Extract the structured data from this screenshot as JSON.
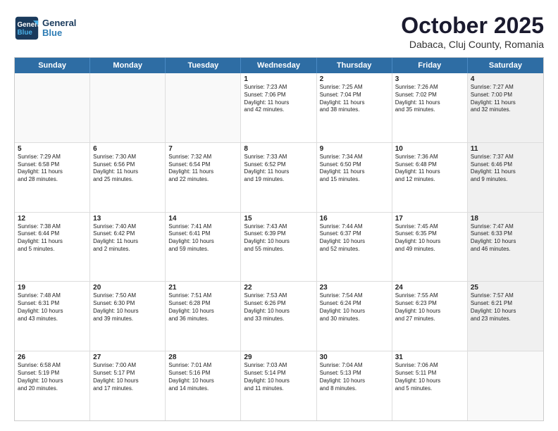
{
  "logo": {
    "line1": "General",
    "line2": "Blue"
  },
  "title": "October 2025",
  "subtitle": "Dabaca, Cluj County, Romania",
  "days": [
    "Sunday",
    "Monday",
    "Tuesday",
    "Wednesday",
    "Thursday",
    "Friday",
    "Saturday"
  ],
  "rows": [
    [
      {
        "day": "",
        "text": "",
        "empty": true
      },
      {
        "day": "",
        "text": "",
        "empty": true
      },
      {
        "day": "",
        "text": "",
        "empty": true
      },
      {
        "day": "1",
        "text": "Sunrise: 7:23 AM\nSunset: 7:06 PM\nDaylight: 11 hours\nand 42 minutes."
      },
      {
        "day": "2",
        "text": "Sunrise: 7:25 AM\nSunset: 7:04 PM\nDaylight: 11 hours\nand 38 minutes."
      },
      {
        "day": "3",
        "text": "Sunrise: 7:26 AM\nSunset: 7:02 PM\nDaylight: 11 hours\nand 35 minutes."
      },
      {
        "day": "4",
        "text": "Sunrise: 7:27 AM\nSunset: 7:00 PM\nDaylight: 11 hours\nand 32 minutes.",
        "shaded": true
      }
    ],
    [
      {
        "day": "5",
        "text": "Sunrise: 7:29 AM\nSunset: 6:58 PM\nDaylight: 11 hours\nand 28 minutes."
      },
      {
        "day": "6",
        "text": "Sunrise: 7:30 AM\nSunset: 6:56 PM\nDaylight: 11 hours\nand 25 minutes."
      },
      {
        "day": "7",
        "text": "Sunrise: 7:32 AM\nSunset: 6:54 PM\nDaylight: 11 hours\nand 22 minutes."
      },
      {
        "day": "8",
        "text": "Sunrise: 7:33 AM\nSunset: 6:52 PM\nDaylight: 11 hours\nand 19 minutes."
      },
      {
        "day": "9",
        "text": "Sunrise: 7:34 AM\nSunset: 6:50 PM\nDaylight: 11 hours\nand 15 minutes."
      },
      {
        "day": "10",
        "text": "Sunrise: 7:36 AM\nSunset: 6:48 PM\nDaylight: 11 hours\nand 12 minutes."
      },
      {
        "day": "11",
        "text": "Sunrise: 7:37 AM\nSunset: 6:46 PM\nDaylight: 11 hours\nand 9 minutes.",
        "shaded": true
      }
    ],
    [
      {
        "day": "12",
        "text": "Sunrise: 7:38 AM\nSunset: 6:44 PM\nDaylight: 11 hours\nand 5 minutes."
      },
      {
        "day": "13",
        "text": "Sunrise: 7:40 AM\nSunset: 6:42 PM\nDaylight: 11 hours\nand 2 minutes."
      },
      {
        "day": "14",
        "text": "Sunrise: 7:41 AM\nSunset: 6:41 PM\nDaylight: 10 hours\nand 59 minutes."
      },
      {
        "day": "15",
        "text": "Sunrise: 7:43 AM\nSunset: 6:39 PM\nDaylight: 10 hours\nand 55 minutes."
      },
      {
        "day": "16",
        "text": "Sunrise: 7:44 AM\nSunset: 6:37 PM\nDaylight: 10 hours\nand 52 minutes."
      },
      {
        "day": "17",
        "text": "Sunrise: 7:45 AM\nSunset: 6:35 PM\nDaylight: 10 hours\nand 49 minutes."
      },
      {
        "day": "18",
        "text": "Sunrise: 7:47 AM\nSunset: 6:33 PM\nDaylight: 10 hours\nand 46 minutes.",
        "shaded": true
      }
    ],
    [
      {
        "day": "19",
        "text": "Sunrise: 7:48 AM\nSunset: 6:31 PM\nDaylight: 10 hours\nand 43 minutes."
      },
      {
        "day": "20",
        "text": "Sunrise: 7:50 AM\nSunset: 6:30 PM\nDaylight: 10 hours\nand 39 minutes."
      },
      {
        "day": "21",
        "text": "Sunrise: 7:51 AM\nSunset: 6:28 PM\nDaylight: 10 hours\nand 36 minutes."
      },
      {
        "day": "22",
        "text": "Sunrise: 7:53 AM\nSunset: 6:26 PM\nDaylight: 10 hours\nand 33 minutes."
      },
      {
        "day": "23",
        "text": "Sunrise: 7:54 AM\nSunset: 6:24 PM\nDaylight: 10 hours\nand 30 minutes."
      },
      {
        "day": "24",
        "text": "Sunrise: 7:55 AM\nSunset: 6:23 PM\nDaylight: 10 hours\nand 27 minutes."
      },
      {
        "day": "25",
        "text": "Sunrise: 7:57 AM\nSunset: 6:21 PM\nDaylight: 10 hours\nand 23 minutes.",
        "shaded": true
      }
    ],
    [
      {
        "day": "26",
        "text": "Sunrise: 6:58 AM\nSunset: 5:19 PM\nDaylight: 10 hours\nand 20 minutes."
      },
      {
        "day": "27",
        "text": "Sunrise: 7:00 AM\nSunset: 5:17 PM\nDaylight: 10 hours\nand 17 minutes."
      },
      {
        "day": "28",
        "text": "Sunrise: 7:01 AM\nSunset: 5:16 PM\nDaylight: 10 hours\nand 14 minutes."
      },
      {
        "day": "29",
        "text": "Sunrise: 7:03 AM\nSunset: 5:14 PM\nDaylight: 10 hours\nand 11 minutes."
      },
      {
        "day": "30",
        "text": "Sunrise: 7:04 AM\nSunset: 5:13 PM\nDaylight: 10 hours\nand 8 minutes."
      },
      {
        "day": "31",
        "text": "Sunrise: 7:06 AM\nSunset: 5:11 PM\nDaylight: 10 hours\nand 5 minutes."
      },
      {
        "day": "",
        "text": "",
        "empty": true,
        "shaded": true
      }
    ]
  ]
}
